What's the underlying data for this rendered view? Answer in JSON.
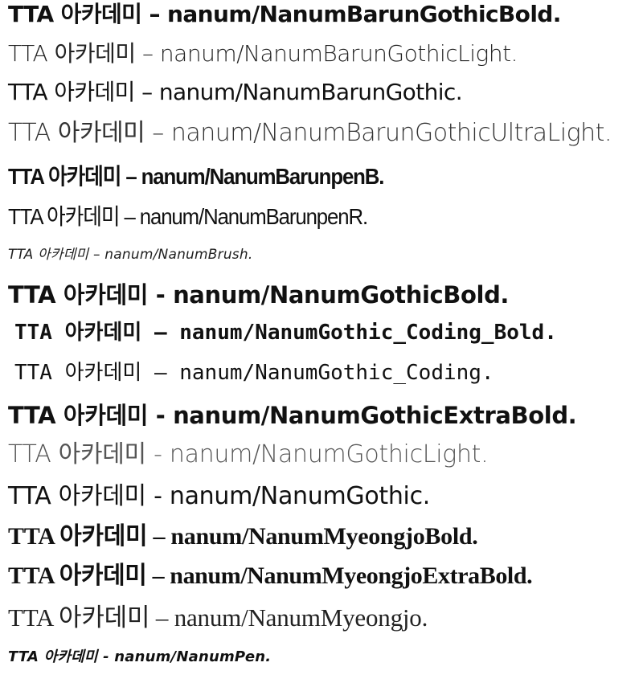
{
  "samples": [
    {
      "text": "TTA 아카데미 – nanum/NanumBarunGothicBold."
    },
    {
      "text": "TTA 아카데미 – nanum/NanumBarunGothicLight."
    },
    {
      "text": "TTA 아카데미 – nanum/NanumBarunGothic."
    },
    {
      "text": "TTA 아카데미 – nanum/NanumBarunGothicUltraLight."
    },
    {
      "text": "TTA 아카데미 – nanum/NanumBarunpenB."
    },
    {
      "text": "TTA 아카데미 – nanum/NanumBarunpenR."
    },
    {
      "text": "TTA 아카데미 – nanum/NanumBrush."
    },
    {
      "text": "TTA 아카데미 - nanum/NanumGothicBold."
    },
    {
      "text": "TTA 아카데미 – nanum/NanumGothic_Coding_Bold."
    },
    {
      "text": "TTA 아카데미 – nanum/NanumGothic_Coding."
    },
    {
      "text": "TTA 아카데미 - nanum/NanumGothicExtraBold."
    },
    {
      "text": "TTA 아카데미 - nanum/NanumGothicLight."
    },
    {
      "text": "TTA 아카데미 - nanum/NanumGothic."
    },
    {
      "text": "TTA 아카데미 – nanum/NanumMyeongjoBold."
    },
    {
      "text": "TTA 아카데미 – nanum/NanumMyeongjoExtraBold."
    },
    {
      "text": "TTA 아카데미 – nanum/NanumMyeongjo."
    },
    {
      "text": "TTA 아카데미 - nanum/NanumPen."
    }
  ]
}
